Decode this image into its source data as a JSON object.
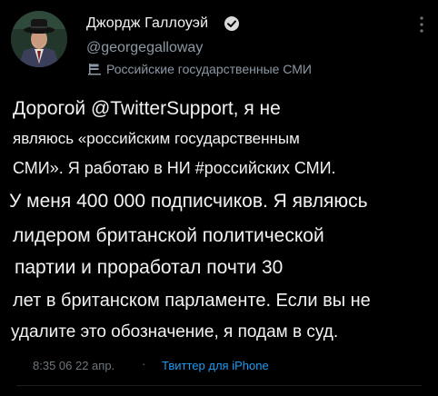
{
  "author": {
    "display_name": "Джордж Галлоуэй",
    "handle": "@georgegalloway",
    "label": "Российские государственные СМИ",
    "avatar_icon": "profile-photo",
    "verified_icon": "verified-badge-icon",
    "label_icon": "flag-icon"
  },
  "tweet": {
    "lines": [
      "Дорогой @TwitterSupport, я не",
      "являюсь «российским государственным",
      "СМИ». Я работаю в НИ #российских СМИ.",
      "У меня 400 000 подписчиков. Я являюсь",
      "лидером британской политической",
      "партии и проработал почти 30",
      "лет в британском парламенте. Если вы не",
      "удалите это обозначение, я подам в суд."
    ]
  },
  "meta": {
    "timestamp": "8:35 06 22 апр.",
    "separator": "·",
    "source": "Твиттер для iPhone"
  },
  "colors": {
    "background": "#000000",
    "text": "#f2f2f2",
    "secondary": "#8b98a5",
    "link": "#1d9bf0"
  }
}
